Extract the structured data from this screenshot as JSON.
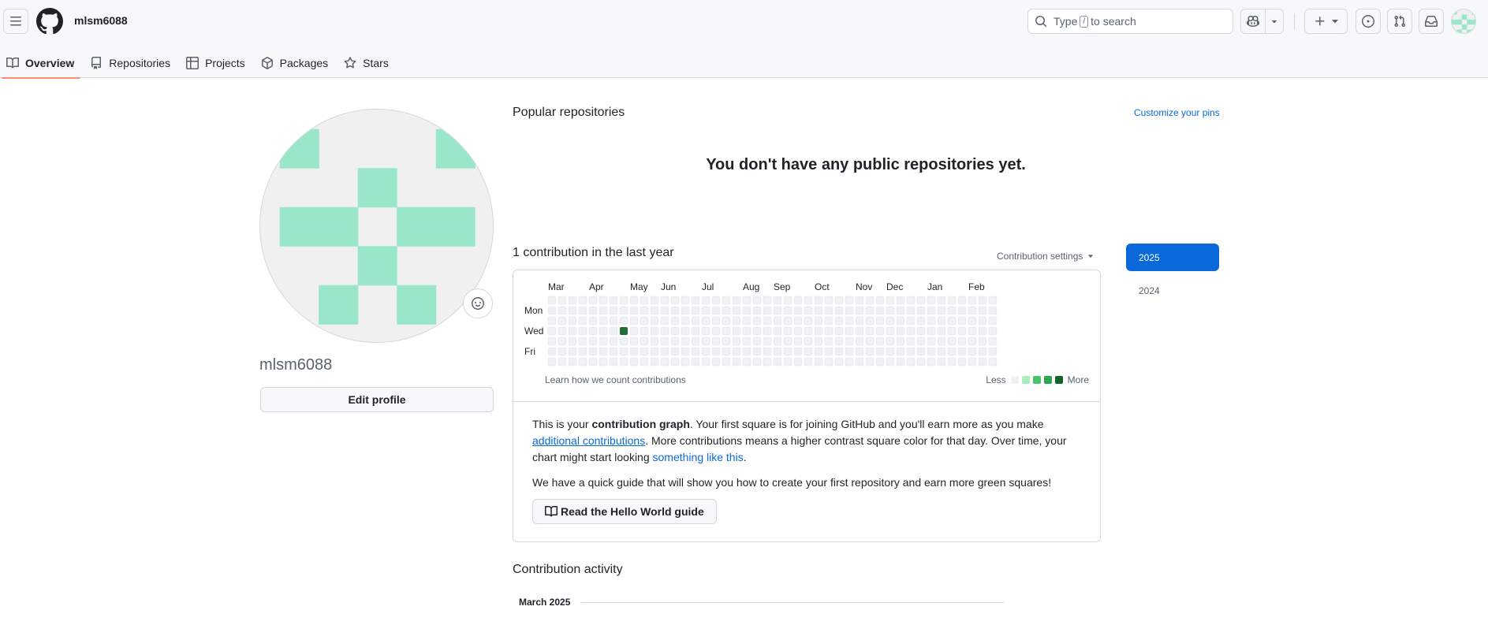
{
  "header": {
    "username": "mlsm6088",
    "search_placeholder_before": "Type",
    "search_key": "/",
    "search_placeholder_after": "to search"
  },
  "tabs": [
    {
      "label": "Overview",
      "icon": "book-icon",
      "active": true
    },
    {
      "label": "Repositories",
      "icon": "repo-icon",
      "active": false
    },
    {
      "label": "Projects",
      "icon": "table-icon",
      "active": false
    },
    {
      "label": "Packages",
      "icon": "package-icon",
      "active": false
    },
    {
      "label": "Stars",
      "icon": "star-icon",
      "active": false
    }
  ],
  "profile": {
    "name": "mlsm6088",
    "edit_label": "Edit profile",
    "identicon_color": "#9ae6c8"
  },
  "popular": {
    "title": "Popular repositories",
    "customize_label": "Customize your pins",
    "empty_message": "You don't have any public repositories yet."
  },
  "contributions": {
    "title": "1 contribution in the last year",
    "settings_label": "Contribution settings",
    "months": [
      "Mar",
      "Apr",
      "May",
      "Jun",
      "Jul",
      "Aug",
      "Sep",
      "Oct",
      "Nov",
      "Dec",
      "Jan",
      "Feb"
    ],
    "days": [
      "Mon",
      "Wed",
      "Fri"
    ],
    "learn_label": "Learn how we count contributions",
    "legend_less": "Less",
    "legend_more": "More",
    "legend_colors": [
      "#eff2f5",
      "#aceebb",
      "#4ac26b",
      "#2da44e",
      "#116329"
    ],
    "empty_color": "#eff2f5",
    "active_color": "#216e39",
    "active_cell": {
      "week": 7,
      "day": 3,
      "count": 1
    }
  },
  "info": {
    "p1_a": "This is your ",
    "p1_b": "contribution graph",
    "p1_c": ". Your first square is for joining GitHub and you'll earn more as you make ",
    "p1_link": "additional contributions",
    "p1_d": ". More contributions means a higher contrast square color for that day. Over time, your chart might start looking ",
    "p1_link2": "something like this",
    "p1_e": ".",
    "p2": "We have a quick guide that will show you how to create your first repository and earn more green squares!",
    "guide_label": "Read the Hello World guide"
  },
  "activity": {
    "title": "Contribution activity",
    "month": "March 2025"
  },
  "years": [
    "2025",
    "2024"
  ]
}
